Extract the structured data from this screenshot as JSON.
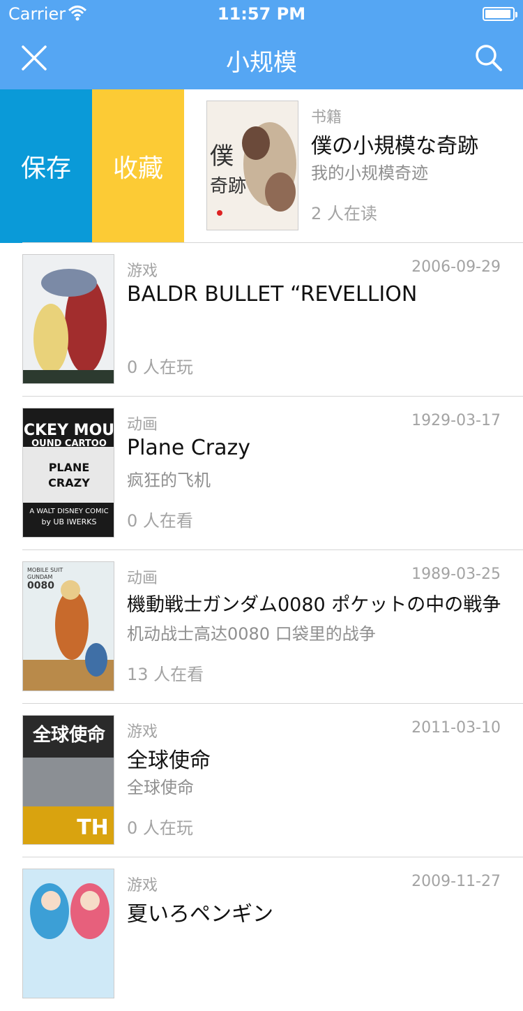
{
  "status_bar": {
    "carrier": "Carrier",
    "time": "11:57 PM"
  },
  "nav": {
    "title": "小规模"
  },
  "swipe_actions": {
    "save": "保存",
    "favorite": "收藏"
  },
  "items": [
    {
      "category": "书籍",
      "date": "",
      "title": "僕の小規模な奇跡",
      "subtitle": "我的小规模奇迹",
      "count": "2 人在读"
    },
    {
      "category": "游戏",
      "date": "2006-09-29",
      "title": "BALDR BULLET “REVELLION",
      "subtitle": "",
      "count": "0 人在玩"
    },
    {
      "category": "动画",
      "date": "1929-03-17",
      "title": "Plane Crazy",
      "subtitle": "疯狂的飞机",
      "count": "0 人在看"
    },
    {
      "category": "动画",
      "date": "1989-03-25",
      "title": "機動戦士ガンダム0080 ポケットの中の戦争",
      "subtitle": "机动战士高达0080 口袋里的战争",
      "count": "13 人在看"
    },
    {
      "category": "游戏",
      "date": "2011-03-10",
      "title": "全球使命",
      "subtitle": "全球使命",
      "count": "0 人在玩"
    },
    {
      "category": "游戏",
      "date": "2009-11-27",
      "title": "夏いろペンギン",
      "subtitle": "",
      "count": ""
    }
  ],
  "covers": {
    "0": {
      "text": "僕の小規模な奇跡"
    },
    "2": {
      "lines": [
        "CKEY MOU",
        "OUND CARTOO",
        "PLANE",
        "CRAZY",
        "A WALT DISNEY COMIC",
        "by UB IWERKS"
      ]
    },
    "3": {
      "lines": [
        "MOBILE SUIT",
        "GUNDAM",
        "0080"
      ]
    },
    "4": {
      "lines": [
        "全球使命"
      ]
    }
  }
}
